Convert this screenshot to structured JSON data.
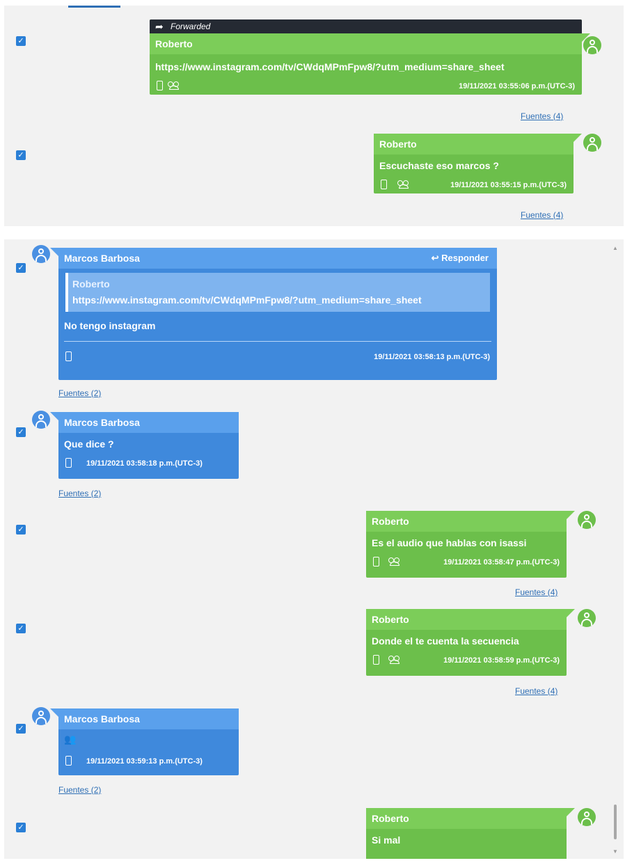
{
  "top_panel": {
    "messages": [
      {
        "forwarded_label": "Forwarded",
        "sender": "Roberto",
        "text": "https://www.instagram.com/tv/CWdqMPmFpw8/?utm_medium=share_sheet",
        "timestamp": "19/11/2021 03:55:06 p.m.(UTC-3)",
        "sources": "Fuentes (4)"
      },
      {
        "sender": "Roberto",
        "text": "Escuchaste eso marcos ?",
        "timestamp": "19/11/2021 03:55:15 p.m.(UTC-3)",
        "sources": "Fuentes (4)"
      }
    ]
  },
  "bottom_panel": {
    "messages": [
      {
        "sender": "Marcos Barbosa",
        "reply_label": "Responder",
        "quote_sender": "Roberto",
        "quote_text": "https://www.instagram.com/tv/CWdqMPmFpw8/?utm_medium=share_sheet",
        "text": "No tengo instagram",
        "timestamp": "19/11/2021 03:58:13 p.m.(UTC-3)",
        "sources": "Fuentes (2)"
      },
      {
        "sender": "Marcos Barbosa",
        "text": "Que dice ?",
        "timestamp": "19/11/2021 03:58:18 p.m.(UTC-3)",
        "sources": "Fuentes (2)"
      },
      {
        "sender": "Roberto",
        "text": "Es el audio que hablas con isassi",
        "timestamp": "19/11/2021 03:58:47 p.m.(UTC-3)",
        "sources": "Fuentes (4)"
      },
      {
        "sender": "Roberto",
        "text": "Donde el te cuenta la secuencia",
        "timestamp": "19/11/2021 03:58:59 p.m.(UTC-3)",
        "sources": "Fuentes (4)"
      },
      {
        "sender": "Marcos Barbosa",
        "text": "👥",
        "timestamp": "19/11/2021 03:59:13 p.m.(UTC-3)",
        "sources": "Fuentes (2)"
      },
      {
        "sender": "Roberto",
        "text": "Si mal"
      }
    ]
  },
  "icons": {
    "checkbox": "checkbox-checked-icon",
    "avatar": "user-avatar-icon",
    "device": "phone-icon",
    "group": "group-icon",
    "forward": "forward-arrow-icon",
    "reply": "reply-arrow-icon"
  },
  "colors": {
    "outgoing_bubble": "#6cbf4b",
    "incoming_bubble": "#3f89dc",
    "forwarded_bar": "#252a33",
    "link": "#2f6fb5",
    "checkbox": "#2a7fd6"
  }
}
